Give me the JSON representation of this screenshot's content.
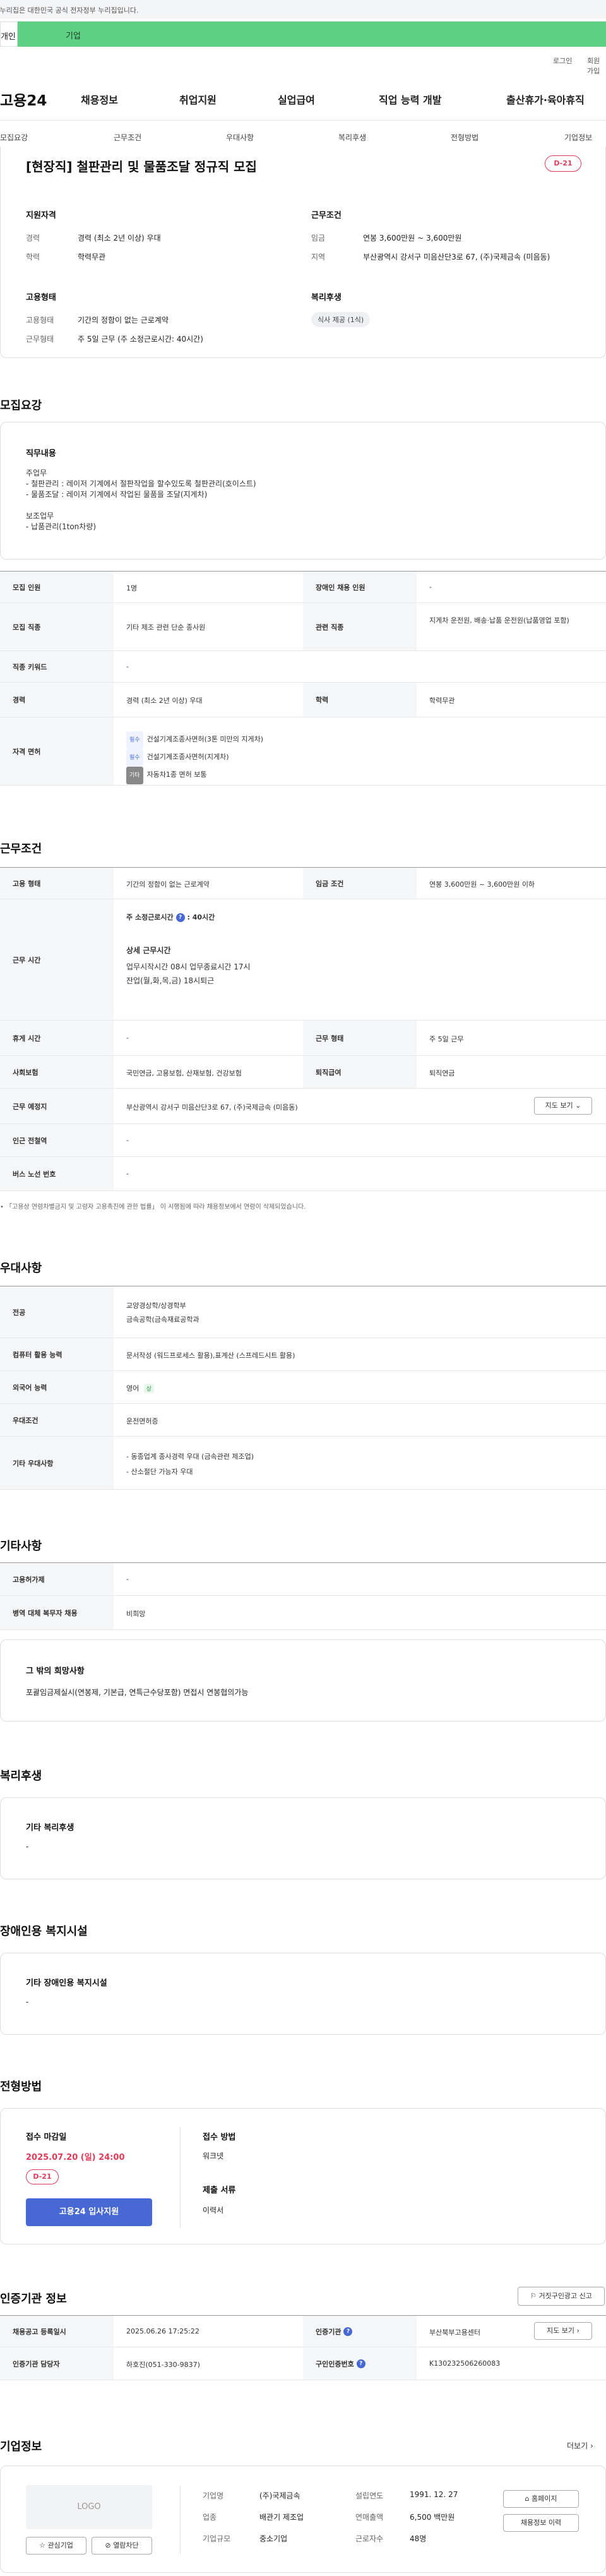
{
  "gov_notice": "이 누리집은 대한민국 공식 전자정부 누리집입니다.",
  "tabs": [
    "개인",
    "기업"
  ],
  "util": {
    "login": "로그인",
    "join": "회원가입"
  },
  "logo": "고용24",
  "gnb": [
    "채용정보",
    "취업지원",
    "실업급여",
    "직업 능력 개발",
    "출산휴가·육아휴직"
  ],
  "snb": [
    "모집요강",
    "근무조건",
    "우대사항",
    "복리후생",
    "전형방법",
    "기업정보"
  ],
  "job": {
    "title": "[현장직] 철판관리 및 물품조달 정규직 모집",
    "dday": "D-21",
    "qual_h": "지원자격",
    "cond_h": "근무조건",
    "career_l": "경력",
    "career_v": "경력 (최소 2년 이상) 우대",
    "edu_l": "학력",
    "edu_v": "학력무관",
    "wage_l": "임금",
    "wage_v": "연봉 3,600만원 ~ 3,600만원",
    "area_l": "지역",
    "area_v": "부산광역시 강서구 미음산단3로 67, (주)국제금속 (미음동)",
    "emp_h": "고용형태",
    "emptype_l": "고용형태",
    "emptype_v": "기간의 정함이 없는 근로계약",
    "worktype_l": "근무형태",
    "worktype_v": "주 5일 근무 (주 소정근로시간: 40시간)",
    "welfare_h": "복리후생",
    "welfare_tag": "식사 제공 (1식)"
  },
  "recruit": {
    "h": "모집요강",
    "duty_h": "직무내용",
    "duty_lines": [
      "주업무",
      "- 철판관리 : 레이저 기계에서 절판작업을 할수있도록 철판관리(호이스트)",
      "- 물품조달 : 레이저 기계에서 작업된 물품을 조달(지게차)",
      "",
      "보조업무",
      "- 납품관리(1ton차량)"
    ],
    "rows": [
      {
        "l1": "모집 인원",
        "v1": "1명",
        "l2": "장애인 채용 인원",
        "v2": "-"
      },
      {
        "l1": "모집 직종",
        "v1": "기타 제조 관련 단순 종사원",
        "l2": "관련 직종",
        "v2": "지게차 운전원, 배송·납품 운전원(납품영업 포함)"
      },
      {
        "l1": "직종 키워드",
        "v1": "-"
      },
      {
        "l1": "경력",
        "v1": "경력 (최소 2년 이상) 우대",
        "l2": "학력",
        "v2": "학력무관"
      }
    ],
    "license_l": "자격 면허",
    "licenses": [
      {
        "b": "필수",
        "t": "건설기계조종사면허(3톤 미만의 지게차)"
      },
      {
        "b": "필수",
        "t": "건설기계조종사면허(지게차)"
      },
      {
        "b": "기타",
        "t": "자동차1종 면허 보통"
      }
    ]
  },
  "work": {
    "h": "근무조건",
    "emp_l": "고용 형태",
    "emp_v": "기간의 정함이 없는 근로계약",
    "wage_l": "임금 조건",
    "wage_v": "연봉 3,600만원 ~ 3,600만원 이하",
    "time_l": "근무 시간",
    "time_main": "주 소정근로시간",
    "time_main_v": "40시간",
    "time_sub_h": "상세 근무시간",
    "time_sub": [
      "업무시작시간 08시 업무종료시간 17시",
      "잔업(월,화,목,금) 18시퇴근"
    ],
    "rest_l": "휴게 시간",
    "rest_v": "-",
    "form_l": "근무 형태",
    "form_v": "주 5일 근무",
    "ins_l": "사회보험",
    "ins_v": "국민연금, 고용보험, 산재보험, 건강보험",
    "ret_l": "퇴직급여",
    "ret_v": "퇴직연금",
    "place_l": "근무 예정지",
    "place_v": "부산광역시 강서구 미음산단3로 67, (주)국제금속 (미음동)",
    "map_btn": "지도 보기",
    "sub_l": "인근 전철역",
    "sub_v": "-",
    "bus_l": "버스 노선 번호",
    "bus_v": "-",
    "note": "「고용상 연령차별금지 및 고령자 고용촉진에 관한 법률」 이 시행됨에 따라 채용정보에서 연령이 삭제되었습니다."
  },
  "pref": {
    "h": "우대사항",
    "rows": [
      {
        "l": "전공",
        "v": [
          "교양경상학/상경학부",
          "금속공학(금속재료공학과"
        ]
      },
      {
        "l": "컴퓨터 활용 능력",
        "v": [
          "문서작성 (워드프로세스 활용),표계산 (스프레드시트 활용)"
        ]
      },
      {
        "l": "외국어 능력",
        "v": [
          "영어"
        ],
        "badge": "상"
      },
      {
        "l": "우대조건",
        "v": [
          "운전면허증"
        ]
      },
      {
        "l": "기타 우대사항",
        "v": [
          "- 동종업계 종사경력 우대 (금속관련 제조업)",
          "- 산소절단 가능자 우대"
        ]
      }
    ]
  },
  "etc": {
    "h": "기타사항",
    "rows": [
      {
        "l": "고용허가제",
        "v": "-"
      },
      {
        "l": "병역 대체 복무자 채용",
        "v": "비희망"
      }
    ],
    "hope_h": "그 밖의 희망사항",
    "hope_v": "포괄임금제실시(연봉제, 기본급, 연특근수당포함) 면접시 연봉협의가능"
  },
  "benefit": {
    "h": "복리후생",
    "box_h": "기타 복리후생",
    "box_v": "-"
  },
  "disab": {
    "h": "장애인용 복지시설",
    "box_h": "기타 장애인용 복지시설",
    "box_v": "-"
  },
  "process": {
    "h": "전형방법",
    "deadline_h": "접수 마감일",
    "deadline_v": "2025.07.20 (일) 24:00",
    "dday": "D-21",
    "apply_btn": "고용24 입사지원",
    "method_h": "접수 방법",
    "method_v": "워크넷",
    "docs_h": "제출 서류",
    "docs_v": "이력서"
  },
  "agency": {
    "h": "인증기관 정보",
    "report_btn": "거짓구인광고 신고",
    "reg_l": "채용공고 등록일시",
    "reg_v": "2025.06.26 17:25:22",
    "org_l": "인증기관",
    "org_v": "부산북부고용센터",
    "map_btn": "지도 보기",
    "mgr_l": "인증기관 담당자",
    "mgr_v": "하호진(051-330-9837)",
    "id_l": "구인인증번호",
    "id_v": "K130232506260083"
  },
  "company": {
    "h": "기업정보",
    "more": "더보기",
    "logo": "LOGO",
    "fav_btn": "관심기업",
    "block_btn": "열람차단",
    "name_l": "기업명",
    "name_v": "(주)국제금속",
    "ind_l": "업종",
    "ind_v": "배관기 제조업",
    "size_l": "기업규모",
    "size_v": "중소기업",
    "est_l": "설립연도",
    "est_v": "1991. 12. 27",
    "sales_l": "연매출액",
    "sales_v": "6,500 백만원",
    "emp_l": "근로자수",
    "emp_v": "48명",
    "home_btn": "홈페이지",
    "jobs_btn": "채용정보 이력"
  },
  "colors": {
    "accent": "#4868d4",
    "dday": "#e23b5a",
    "tab_green": "#5fd084"
  }
}
